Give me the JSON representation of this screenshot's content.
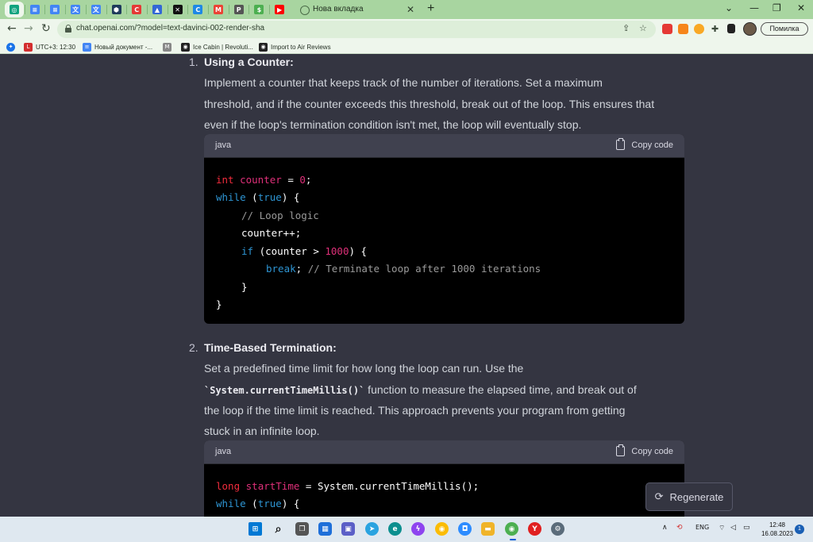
{
  "browser": {
    "tabs": [
      {
        "name": "chatgpt",
        "color": "#10a37f",
        "glyph": "◎"
      },
      {
        "name": "docs",
        "color": "#4285f4",
        "glyph": "≡"
      },
      {
        "name": "docs",
        "color": "#4285f4",
        "glyph": "≡"
      },
      {
        "name": "translate",
        "color": "#4285f4",
        "glyph": "文"
      },
      {
        "name": "translate",
        "color": "#4285f4",
        "glyph": "文"
      },
      {
        "name": "shield",
        "color": "#1f3b5c",
        "glyph": "⬢"
      },
      {
        "name": "c-app",
        "color": "#e53935",
        "glyph": "C"
      },
      {
        "name": "drive",
        "color": "#3367d6",
        "glyph": "▲"
      },
      {
        "name": "capcut",
        "color": "#111111",
        "glyph": "✕"
      },
      {
        "name": "c-blue",
        "color": "#1e88e5",
        "glyph": "C"
      },
      {
        "name": "gmail",
        "color": "#ea4335",
        "glyph": "M"
      },
      {
        "name": "p-app",
        "color": "#555555",
        "glyph": "P"
      },
      {
        "name": "dollar",
        "color": "#4caf50",
        "glyph": "$"
      },
      {
        "name": "youtube",
        "color": "#ff0000",
        "glyph": "▶"
      }
    ],
    "open_tab_title": "Нова вкладка",
    "new_tab": "+",
    "window_controls": [
      "⌄",
      "—",
      "❐",
      "✕"
    ],
    "url": "chat.openai.com/?model=text-davinci-002-render-sha",
    "error_button": "Помилка",
    "bookmarks": [
      {
        "label": "UTC+3: 12:30",
        "color": "#d32f2f",
        "glyph": "L"
      },
      {
        "label": "Новый документ -...",
        "color": "#4285f4",
        "glyph": "≡"
      },
      {
        "label": "",
        "color": "#888888",
        "glyph": "M"
      },
      {
        "label": "Ice Cabin | Revoluti...",
        "color": "#222222",
        "glyph": "◉"
      },
      {
        "label": "Import to Air Reviews",
        "color": "#222222",
        "glyph": "◉"
      }
    ]
  },
  "answer": {
    "items": [
      {
        "number": "1.",
        "title": "Using a Counter:",
        "lines": [
          "Implement a counter that keeps track of the number of iterations. Set a maximum",
          "threshold, and if the counter exceeds this threshold, break out of the loop. This ensures that",
          "even if the loop's termination condition isn't met, the loop will eventually stop."
        ],
        "code_lang": "java",
        "copy_label": "Copy code"
      },
      {
        "number": "2.",
        "title": "Time-Based Termination:",
        "line1": "Set a predefined time limit for how long the loop can run. Use the",
        "line2_code": "`System.currentTimeMillis()`",
        "line2_rest": " function to measure the elapsed time, and break out of",
        "line3": "the loop if the time limit is reached. This approach prevents your program from getting",
        "line4": "stuck in an infinite loop.",
        "code_lang": "java",
        "copy_label": "Copy code"
      }
    ],
    "code1": {
      "l1_type": "int",
      "l1_var": "counter",
      "l1_op": " = ",
      "l1_num": "0",
      "l1_end": ";",
      "l2_kw": "while",
      "l2_a": " (",
      "l2_true": "true",
      "l2_b": ") {",
      "l3_comment": "// Loop logic",
      "l4": "counter++;",
      "l5_kw": "if",
      "l5_a": " (counter > ",
      "l5_num": "1000",
      "l5_b": ") {",
      "l6_kw": "break",
      "l6_a": "; ",
      "l6_comment": "// Terminate loop after 1000 iterations",
      "l7": "}",
      "l8": "}"
    },
    "code2": {
      "l1_type": "long",
      "l1_var": "startTime",
      "l1_rest": " = System.currentTimeMillis();",
      "l2_kw": "while",
      "l2_a": " (",
      "l2_true": "true",
      "l2_b": ") {"
    }
  },
  "regenerate_label": "Regenerate",
  "taskbar": {
    "lang": "ENG",
    "time": "12:48",
    "date": "16.08.2023",
    "notifications": "1"
  }
}
